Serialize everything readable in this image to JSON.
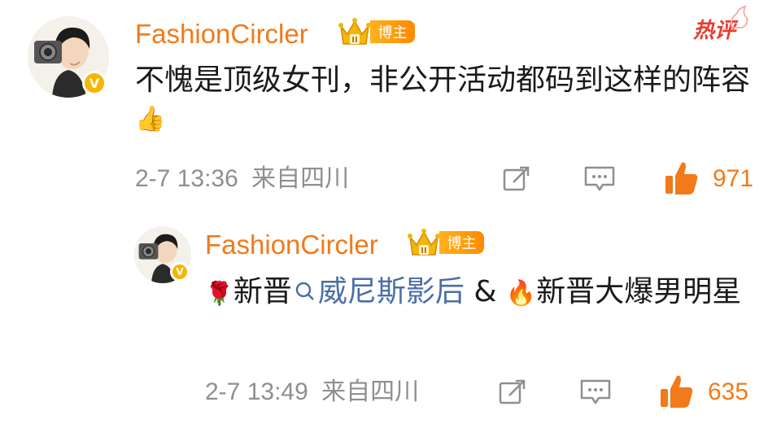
{
  "comments": [
    {
      "username": "FashionCircler",
      "badge": "博主",
      "hot_label": "热评",
      "text": "不愧是顶级女刊，非公开活动都码到这样的阵容",
      "emoji": "👍",
      "time": "2-7 13:36",
      "source": "来自四川",
      "likes": "971"
    },
    {
      "username": "FashionCircler",
      "badge": "博主",
      "text_pre": "新晋",
      "link": "威尼斯影后",
      "text_mid": " & ",
      "text_post": "新晋大爆男明星",
      "emoji_rose": "🌹",
      "emoji_fire": "🔥",
      "time": "2-7 13:49",
      "source": "来自四川",
      "likes": "635"
    }
  ],
  "icons": {
    "repost": "repost-icon",
    "comment": "comment-icon",
    "like": "thumbs-up-icon",
    "search": "search-icon",
    "verified": "verified-v-icon",
    "crown": "crown-icon"
  },
  "colors": {
    "username": "#f27a1a",
    "meta": "#8f8f8f",
    "like": "#f27a1a",
    "link": "#4a6ea8",
    "hot": "#e63c2f",
    "badge": "#ff9c0a"
  }
}
